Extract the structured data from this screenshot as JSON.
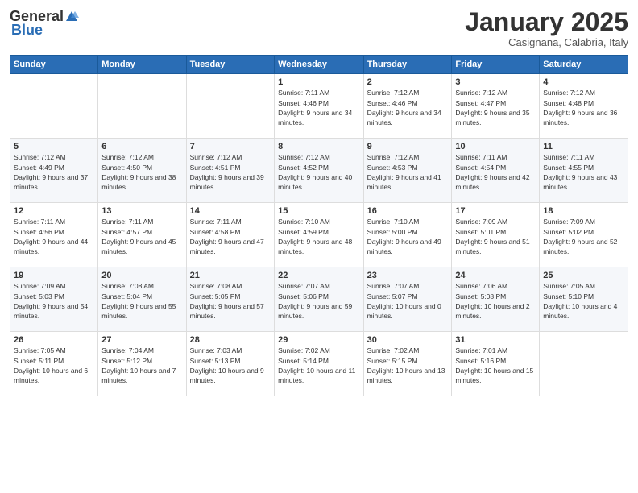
{
  "logo": {
    "general": "General",
    "blue": "Blue"
  },
  "title": "January 2025",
  "subtitle": "Casignana, Calabria, Italy",
  "weekdays": [
    "Sunday",
    "Monday",
    "Tuesday",
    "Wednesday",
    "Thursday",
    "Friday",
    "Saturday"
  ],
  "weeks": [
    [
      {
        "day": "",
        "sunrise": "",
        "sunset": "",
        "daylight": ""
      },
      {
        "day": "",
        "sunrise": "",
        "sunset": "",
        "daylight": ""
      },
      {
        "day": "",
        "sunrise": "",
        "sunset": "",
        "daylight": ""
      },
      {
        "day": "1",
        "sunrise": "Sunrise: 7:11 AM",
        "sunset": "Sunset: 4:46 PM",
        "daylight": "Daylight: 9 hours and 34 minutes."
      },
      {
        "day": "2",
        "sunrise": "Sunrise: 7:12 AM",
        "sunset": "Sunset: 4:46 PM",
        "daylight": "Daylight: 9 hours and 34 minutes."
      },
      {
        "day": "3",
        "sunrise": "Sunrise: 7:12 AM",
        "sunset": "Sunset: 4:47 PM",
        "daylight": "Daylight: 9 hours and 35 minutes."
      },
      {
        "day": "4",
        "sunrise": "Sunrise: 7:12 AM",
        "sunset": "Sunset: 4:48 PM",
        "daylight": "Daylight: 9 hours and 36 minutes."
      }
    ],
    [
      {
        "day": "5",
        "sunrise": "Sunrise: 7:12 AM",
        "sunset": "Sunset: 4:49 PM",
        "daylight": "Daylight: 9 hours and 37 minutes."
      },
      {
        "day": "6",
        "sunrise": "Sunrise: 7:12 AM",
        "sunset": "Sunset: 4:50 PM",
        "daylight": "Daylight: 9 hours and 38 minutes."
      },
      {
        "day": "7",
        "sunrise": "Sunrise: 7:12 AM",
        "sunset": "Sunset: 4:51 PM",
        "daylight": "Daylight: 9 hours and 39 minutes."
      },
      {
        "day": "8",
        "sunrise": "Sunrise: 7:12 AM",
        "sunset": "Sunset: 4:52 PM",
        "daylight": "Daylight: 9 hours and 40 minutes."
      },
      {
        "day": "9",
        "sunrise": "Sunrise: 7:12 AM",
        "sunset": "Sunset: 4:53 PM",
        "daylight": "Daylight: 9 hours and 41 minutes."
      },
      {
        "day": "10",
        "sunrise": "Sunrise: 7:11 AM",
        "sunset": "Sunset: 4:54 PM",
        "daylight": "Daylight: 9 hours and 42 minutes."
      },
      {
        "day": "11",
        "sunrise": "Sunrise: 7:11 AM",
        "sunset": "Sunset: 4:55 PM",
        "daylight": "Daylight: 9 hours and 43 minutes."
      }
    ],
    [
      {
        "day": "12",
        "sunrise": "Sunrise: 7:11 AM",
        "sunset": "Sunset: 4:56 PM",
        "daylight": "Daylight: 9 hours and 44 minutes."
      },
      {
        "day": "13",
        "sunrise": "Sunrise: 7:11 AM",
        "sunset": "Sunset: 4:57 PM",
        "daylight": "Daylight: 9 hours and 45 minutes."
      },
      {
        "day": "14",
        "sunrise": "Sunrise: 7:11 AM",
        "sunset": "Sunset: 4:58 PM",
        "daylight": "Daylight: 9 hours and 47 minutes."
      },
      {
        "day": "15",
        "sunrise": "Sunrise: 7:10 AM",
        "sunset": "Sunset: 4:59 PM",
        "daylight": "Daylight: 9 hours and 48 minutes."
      },
      {
        "day": "16",
        "sunrise": "Sunrise: 7:10 AM",
        "sunset": "Sunset: 5:00 PM",
        "daylight": "Daylight: 9 hours and 49 minutes."
      },
      {
        "day": "17",
        "sunrise": "Sunrise: 7:09 AM",
        "sunset": "Sunset: 5:01 PM",
        "daylight": "Daylight: 9 hours and 51 minutes."
      },
      {
        "day": "18",
        "sunrise": "Sunrise: 7:09 AM",
        "sunset": "Sunset: 5:02 PM",
        "daylight": "Daylight: 9 hours and 52 minutes."
      }
    ],
    [
      {
        "day": "19",
        "sunrise": "Sunrise: 7:09 AM",
        "sunset": "Sunset: 5:03 PM",
        "daylight": "Daylight: 9 hours and 54 minutes."
      },
      {
        "day": "20",
        "sunrise": "Sunrise: 7:08 AM",
        "sunset": "Sunset: 5:04 PM",
        "daylight": "Daylight: 9 hours and 55 minutes."
      },
      {
        "day": "21",
        "sunrise": "Sunrise: 7:08 AM",
        "sunset": "Sunset: 5:05 PM",
        "daylight": "Daylight: 9 hours and 57 minutes."
      },
      {
        "day": "22",
        "sunrise": "Sunrise: 7:07 AM",
        "sunset": "Sunset: 5:06 PM",
        "daylight": "Daylight: 9 hours and 59 minutes."
      },
      {
        "day": "23",
        "sunrise": "Sunrise: 7:07 AM",
        "sunset": "Sunset: 5:07 PM",
        "daylight": "Daylight: 10 hours and 0 minutes."
      },
      {
        "day": "24",
        "sunrise": "Sunrise: 7:06 AM",
        "sunset": "Sunset: 5:08 PM",
        "daylight": "Daylight: 10 hours and 2 minutes."
      },
      {
        "day": "25",
        "sunrise": "Sunrise: 7:05 AM",
        "sunset": "Sunset: 5:10 PM",
        "daylight": "Daylight: 10 hours and 4 minutes."
      }
    ],
    [
      {
        "day": "26",
        "sunrise": "Sunrise: 7:05 AM",
        "sunset": "Sunset: 5:11 PM",
        "daylight": "Daylight: 10 hours and 6 minutes."
      },
      {
        "day": "27",
        "sunrise": "Sunrise: 7:04 AM",
        "sunset": "Sunset: 5:12 PM",
        "daylight": "Daylight: 10 hours and 7 minutes."
      },
      {
        "day": "28",
        "sunrise": "Sunrise: 7:03 AM",
        "sunset": "Sunset: 5:13 PM",
        "daylight": "Daylight: 10 hours and 9 minutes."
      },
      {
        "day": "29",
        "sunrise": "Sunrise: 7:02 AM",
        "sunset": "Sunset: 5:14 PM",
        "daylight": "Daylight: 10 hours and 11 minutes."
      },
      {
        "day": "30",
        "sunrise": "Sunrise: 7:02 AM",
        "sunset": "Sunset: 5:15 PM",
        "daylight": "Daylight: 10 hours and 13 minutes."
      },
      {
        "day": "31",
        "sunrise": "Sunrise: 7:01 AM",
        "sunset": "Sunset: 5:16 PM",
        "daylight": "Daylight: 10 hours and 15 minutes."
      },
      {
        "day": "",
        "sunrise": "",
        "sunset": "",
        "daylight": ""
      }
    ]
  ]
}
